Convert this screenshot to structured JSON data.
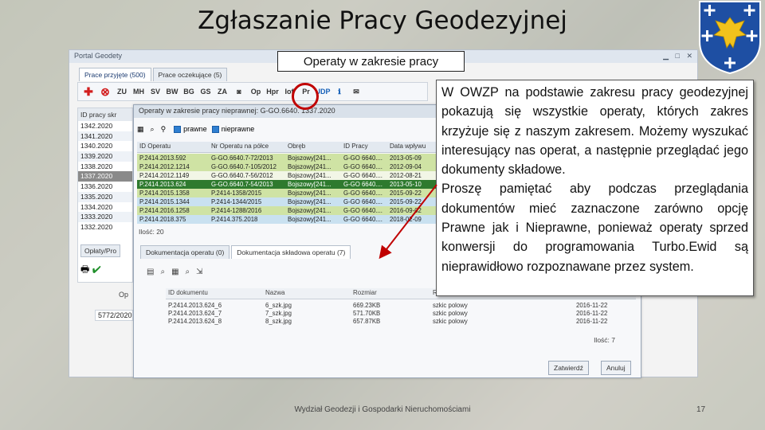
{
  "slide": {
    "title": "Zgłaszanie Pracy Geodezyjnej",
    "footer": "Wydział Geodezji i Gospodarki Nieruchomościami",
    "page_number": "17"
  },
  "annotations": {
    "label": "Operaty w zakresie pracy",
    "info_paragraph_1": "W OWZP na podstawie zakresu pracy geodezyjnej pokazują się wszystkie operaty, których zakres krzyżuje się z naszym zakresem. Możemy wyszukać interesujący nas operat, a następnie przeglądać jego dokumenty składowe.",
    "info_paragraph_2": "Proszę pamiętać aby podczas przeglądania dokumentów mieć zaznaczone zarówno opcję Prawne jak i Nieprawne, ponieważ operaty sprzed konwersji do programowania Turbo.Ewid są nieprawidłowo rozpoznawane przez system.",
    "colors": {
      "highlight_circle": "#c00000",
      "arrow": "#c00000"
    }
  },
  "window": {
    "title": "Portal Geodety",
    "tabs": [
      "Prace przyjęte (500)",
      "Prace oczekujące (5)"
    ],
    "toolbar": [
      "plus-icon",
      "delete-icon",
      "ZU",
      "MH",
      "SV",
      "BW",
      "BG",
      "GS",
      "ZA",
      "camera-icon",
      "Op",
      "Hpr",
      "Iof",
      "Pr",
      "UDP",
      "info-icon",
      "email-icon"
    ],
    "left_list": {
      "header": "ID pracy skr",
      "rows": [
        "1342.2020",
        "1341.2020",
        "1340.2020",
        "1339.2020",
        "1338.2020",
        "1337.2020",
        "1336.2020",
        "1335.2020",
        "1334.2020",
        "1333.2020",
        "1332.2020"
      ],
      "selected_index": 5
    },
    "fees_tab": "Opłaty/Pro",
    "fees_label": "Op",
    "fees_value": "5772/2020"
  },
  "dialog": {
    "title": "Operaty w zakresie pracy nieprawnej: G-GO.6640.  1337.2020",
    "filters": {
      "prawne_label": "prawne",
      "prawne_checked": true,
      "nieprawne_label": "nieprawne",
      "nieprawne_checked": true
    },
    "columns": [
      "ID Operatu",
      "Nr Operatu na półce",
      "Obręb",
      "ID Pracy",
      "Data wpływu"
    ],
    "rows": [
      [
        "P.2414.2013.592",
        "G-GO.6640.7-72/2013",
        "Bojszowy[241...",
        "G-GO 6640....",
        "2013-05-09"
      ],
      [
        "P.2414.2012.1214",
        "G-GO.6640.7-105/2012",
        "Bojszowy[241...",
        "G-GO 6640....",
        "2012-09-04"
      ],
      [
        "P.2414.2012.1149",
        "G-GO.6640.7-56/2012",
        "Bojszowy[241...",
        "G-GO 6640....",
        "2012-08-21"
      ],
      [
        "P.2414.2013.624",
        "G-GO.6640.7-54/2013",
        "Bojszowy[241...",
        "G-GO 6640....",
        "2013-05-10"
      ],
      [
        "P.2414.2015.1358",
        "P.2414-1358/2015",
        "Bojszowy[241...",
        "G-GO 6640....",
        "2015-09-22"
      ],
      [
        "P.2414.2015.1344",
        "P.2414-1344/2015",
        "Bojszowy[241...",
        "G-GO 6640....",
        "2015-09-22"
      ],
      [
        "P.2414.2016.1258",
        "P.2414-1288/2016",
        "Bojszowy[241...",
        "G-GO 6640....",
        "2016-09-02"
      ],
      [
        "P.2414.2018.375",
        "P.2414.375.2018",
        "Bojszowy[241...",
        "G-GO 6640....",
        "2018-02-09"
      ]
    ],
    "row_styles": [
      "g",
      "g",
      "w",
      "sel",
      "g",
      "b",
      "g",
      "b"
    ],
    "count": "Ilość: 20",
    "tabs": [
      "Dokumentacja operatu (0)",
      "Dokumentacja składowa operatu (7)"
    ],
    "doc_columns": [
      "ID dokumentu",
      "Nazwa",
      "Rozmiar",
      "Rodzaj",
      "",
      "Data"
    ],
    "doc_rows": [
      [
        "P.2414.2013.624_6",
        "6_szk.jpg",
        "669.23KB",
        "szkic polowy",
        "",
        "2016-11-22"
      ],
      [
        "P.2414.2013.624_7",
        "7_szk.jpg",
        "571.70KB",
        "szkic polowy",
        "",
        "2016-11-22"
      ],
      [
        "P.2414.2013.624_8",
        "8_szk.jpg",
        "657.87KB",
        "szkic polowy",
        "",
        "2016-11-22"
      ]
    ],
    "doc_count": "Ilość: 7",
    "confirm_button": "Zatwierdź",
    "cancel_button": "Anuluj"
  }
}
